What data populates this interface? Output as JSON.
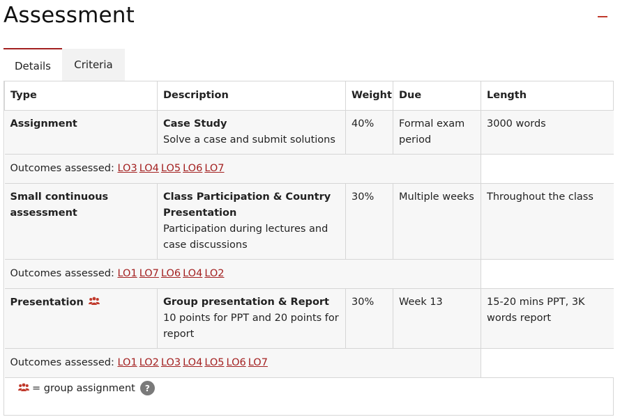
{
  "page": {
    "title": "Assessment",
    "collapse_symbol": "−"
  },
  "tabs": [
    {
      "label": "Details",
      "active": true
    },
    {
      "label": "Criteria",
      "active": false
    }
  ],
  "table": {
    "headers": [
      "Type",
      "Description",
      "Weight",
      "Due",
      "Length"
    ],
    "rows": [
      {
        "type": "Assignment",
        "group": false,
        "desc_title": "Case Study",
        "desc_text": "Solve a case and submit solutions",
        "weight": "40%",
        "due": "Formal exam period",
        "length": "3000 words",
        "outcomes_label": "Outcomes assessed:",
        "outcomes": [
          "LO3",
          "LO4",
          "LO5",
          "LO6",
          "LO7"
        ]
      },
      {
        "type": "Small continuous assessment",
        "group": false,
        "desc_title": "Class Participation & Country Presentation",
        "desc_text": "Participation during lectures and case discussions",
        "weight": "30%",
        "due": "Multiple weeks",
        "length": "Throughout the class",
        "outcomes_label": "Outcomes assessed:",
        "outcomes": [
          "LO1",
          "LO7",
          "LO6",
          "LO4",
          "LO2"
        ]
      },
      {
        "type": "Presentation",
        "group": true,
        "desc_title": "Group presentation & Report",
        "desc_text": "10 points for PPT and 20 points for report",
        "weight": "30%",
        "due": "Week 13",
        "length": "15-20 mins PPT, 3K words report",
        "outcomes_label": "Outcomes assessed:",
        "outcomes": [
          "LO1",
          "LO2",
          "LO3",
          "LO4",
          "LO5",
          "LO6",
          "LO7"
        ]
      }
    ]
  },
  "legend": {
    "text": "= group assignment",
    "help": "?"
  },
  "colors": {
    "accent": "#a32020",
    "icon": "#c0392b",
    "row_bg": "#f7f7f7",
    "border": "#d6d6d6"
  }
}
